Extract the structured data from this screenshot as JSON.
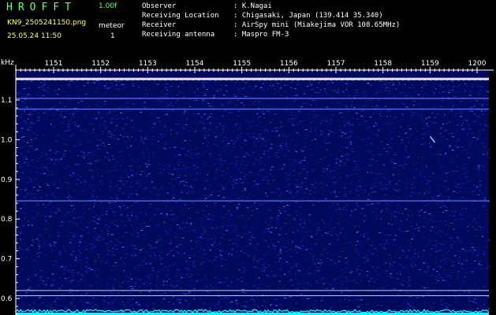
{
  "header": {
    "title": "HROFFT",
    "version": "1.00f",
    "filename": "KN9_2505241150.png",
    "datetime": "25.05.24 11:50",
    "meteor_label": "meteor",
    "meteor_count": "1"
  },
  "info": [
    {
      "label": "Observer",
      "value": ": K.Nagai"
    },
    {
      "label": "Receiving Location",
      "value": ": Chigasaki, Japan (139.414 35.340)"
    },
    {
      "label": "Receiver",
      "value": ": AirSpy mini (Miakejima VOR 108.65MHz)"
    },
    {
      "label": "Receiving antenna",
      "value": ": Maspro FM-3"
    }
  ],
  "chart_data": {
    "type": "heatmap",
    "ylabel": "kHz",
    "x_ticks": [
      "1151",
      "1152",
      "1153",
      "1154",
      "1155",
      "1156",
      "1157",
      "1158",
      "1159",
      "1200"
    ],
    "y_ticks": [
      "1.1",
      "1.0",
      "0.9",
      "0.8",
      "0.7",
      "0.6"
    ],
    "ylim": [
      0.58,
      1.16
    ],
    "xlim": [
      "1150.5",
      "1200.5"
    ],
    "carrier_khz": 1.153,
    "horizontal_lines_khz": [
      1.104,
      1.077,
      0.846,
      0.62,
      0.607
    ],
    "meteor_echo": {
      "start_time": "1159.0",
      "end_time": "1159.1",
      "start_khz": 1.008,
      "end_khz": 0.993
    },
    "colors": {
      "background": "#000a5c",
      "noise": "#1e3cc8",
      "carrier": "#e8a0ff",
      "trace": "#00ffff",
      "axis": "#ffffff"
    }
  }
}
